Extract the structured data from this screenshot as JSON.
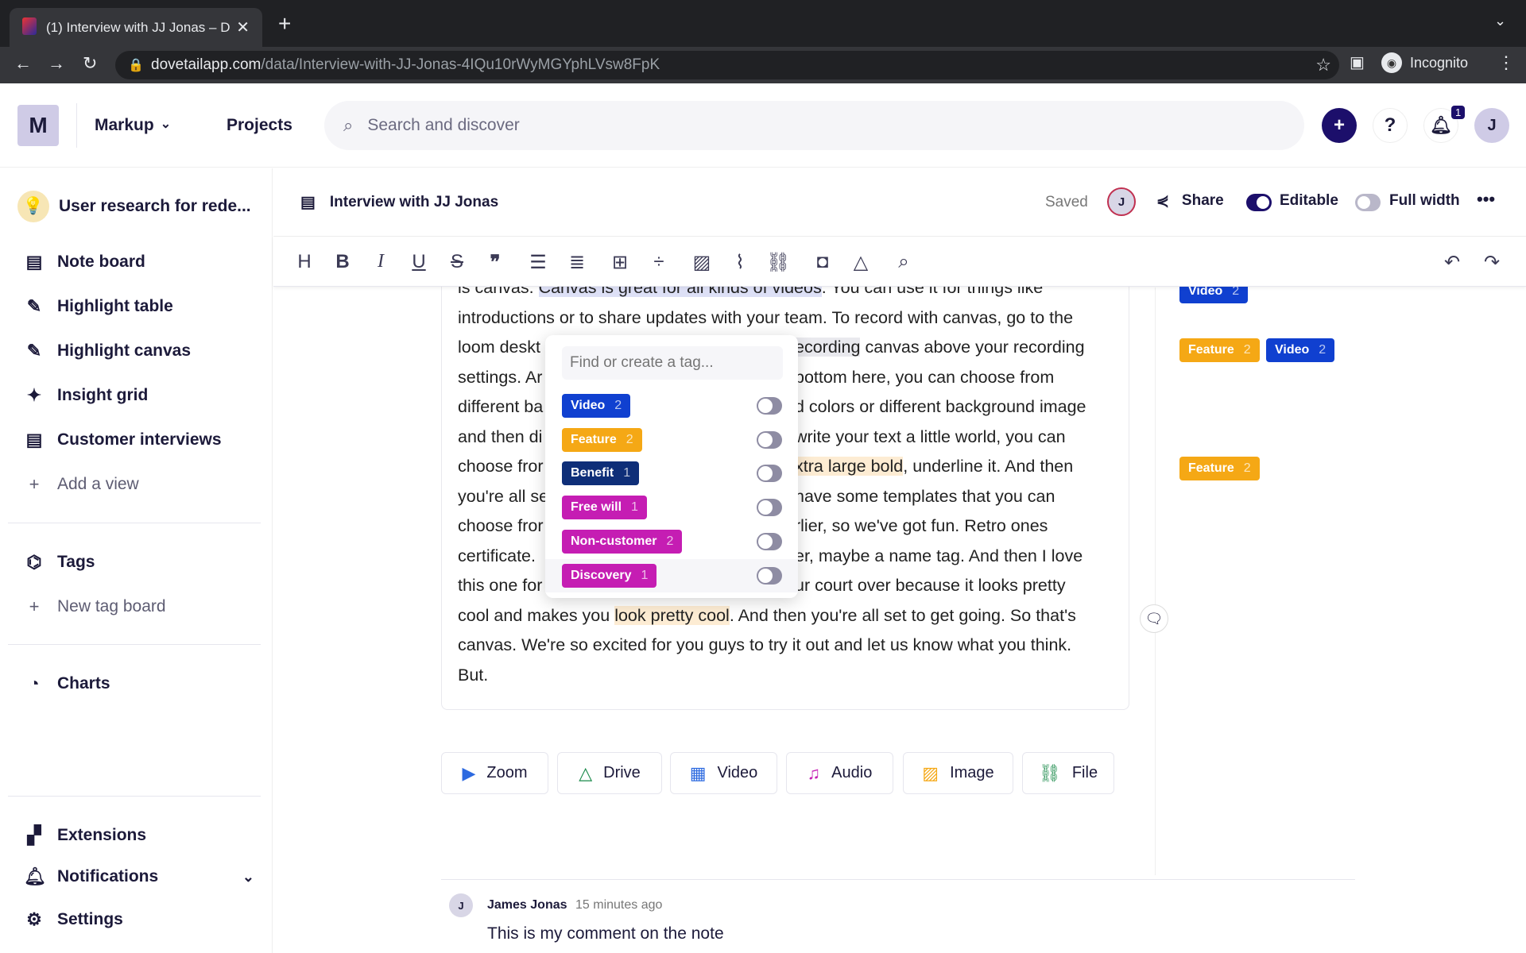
{
  "browser": {
    "tab_title": "(1) Interview with JJ Jonas – D",
    "url_domain": "dovetailapp.com",
    "url_path": "/data/Interview-with-JJ-Jonas-4IQu10rWyMGYphLVsw8FpK",
    "profile": "Incognito"
  },
  "header": {
    "workspace_initial": "M",
    "workspace": "Markup",
    "projects": "Projects",
    "search_placeholder": "Search and discover",
    "notification_count": "1",
    "avatar_initial": "J"
  },
  "sidebar": {
    "project": "User research for rede...",
    "items": [
      {
        "label": "Note board",
        "icon": "note-icon"
      },
      {
        "label": "Highlight table",
        "icon": "highlight-icon"
      },
      {
        "label": "Highlight canvas",
        "icon": "highlight-icon"
      },
      {
        "label": "Insight grid",
        "icon": "sparkle-icon"
      },
      {
        "label": "Customer interviews",
        "icon": "note-icon"
      },
      {
        "label": "Add a view",
        "icon": "plus-icon"
      }
    ],
    "tags": "Tags",
    "new_tag_board": "New tag board",
    "charts": "Charts",
    "extensions": "Extensions",
    "notifications": "Notifications",
    "settings": "Settings"
  },
  "doc": {
    "title": "Interview with JJ Jonas",
    "status": "Saved",
    "avatar": "J",
    "share": "Share",
    "editable": "Editable",
    "editable_on": true,
    "full_width": "Full width",
    "full_width_on": false
  },
  "body": {
    "lines": [
      {
        "a": "is canvas. ",
        "h": "Canvas is great for all kinds of videos",
        "b": ". You can use it for things like"
      },
      {
        "a": "introductions or to share updates with your team. To record with canvas, go to the"
      },
      {
        "a": "loom deskt",
        "r1": "ecording",
        "r2": " canvas above your recording"
      },
      {
        "a": "settings. Ar",
        "r2": "bottom here, you can choose from"
      },
      {
        "a": "different ba",
        "r2": "d colors or different background image"
      },
      {
        "a": "and then di",
        "r2": "write your text a little world, you can"
      },
      {
        "a": "choose fror",
        "r1": "xtra large bold",
        "r2": ", underline it. And then"
      },
      {
        "a": "you're all se",
        "r2": "have some templates that you can"
      },
      {
        "a": "choose fror",
        "r2": "rlier, so we've got fun. Retro ones"
      },
      {
        "a": "certificate.",
        "r2": "er, maybe a name tag. And then I love"
      },
      {
        "a": "this one for",
        "r2": "ur court over because it looks pretty"
      },
      {
        "a": "cool and makes you ",
        "h": "look pretty cool",
        "b": ". And then you're all set to get going. So that's"
      },
      {
        "a": "canvas. We're so excited for you guys to try it out and let us know what you think."
      },
      {
        "a": "But."
      }
    ]
  },
  "popup": {
    "placeholder": "Find or create a tag...",
    "tags": [
      {
        "label": "Video",
        "count": "2",
        "color": "#1040d0"
      },
      {
        "label": "Feature",
        "count": "2",
        "color": "#f5a815"
      },
      {
        "label": "Benefit",
        "count": "1",
        "color": "#0e2e78"
      },
      {
        "label": "Free will",
        "count": "1",
        "color": "#c51db3"
      },
      {
        "label": "Non-customer",
        "count": "2",
        "color": "#c51db3"
      },
      {
        "label": "Discovery",
        "count": "1",
        "color": "#c51db3"
      }
    ]
  },
  "margin_tags": [
    {
      "label": "Video",
      "count": "2",
      "color": "#1040d0"
    },
    {
      "label": "Feature",
      "count": "2",
      "color": "#f5a815"
    },
    {
      "label": "Video",
      "count": "2",
      "color": "#1040d0"
    },
    {
      "label": "Feature",
      "count": "2",
      "color": "#f5a815"
    }
  ],
  "media": [
    {
      "label": "Zoom",
      "icon": "video-camera-icon",
      "color": "#2d6ae0"
    },
    {
      "label": "Drive",
      "icon": "drive-icon",
      "color": "#1a8a4a"
    },
    {
      "label": "Video",
      "icon": "film-icon",
      "color": "#2d6ae0"
    },
    {
      "label": "Audio",
      "icon": "music-icon",
      "color": "#c51db3"
    },
    {
      "label": "Image",
      "icon": "image-icon",
      "color": "#f5a815"
    },
    {
      "label": "File",
      "icon": "link-icon",
      "color": "#1a8a4a"
    }
  ],
  "comment": {
    "avatar": "J",
    "author": "James Jonas",
    "time": "15 minutes ago",
    "text": "This is my comment on the note"
  }
}
